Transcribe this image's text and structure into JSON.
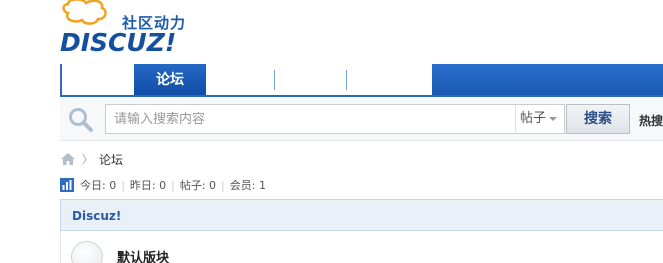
{
  "logo": {
    "tagline": "社区动力",
    "wordmark": "DISCUZ!"
  },
  "nav": {
    "tabs": [
      {
        "label": "论坛",
        "active": true
      }
    ],
    "accent_color": "#1a59b3"
  },
  "search": {
    "placeholder": "请输入搜索内容",
    "value": "",
    "type_selected": "帖子",
    "button_label": "搜索",
    "hot_label": "热搜"
  },
  "breadcrumb": {
    "home_icon": "home-icon",
    "separator": "〉",
    "current": "论坛"
  },
  "stats": {
    "icon": "bar-chart-icon",
    "today": "今日: 0",
    "yesterday": "昨日: 0",
    "posts": "帖子: 0",
    "members": "会员: 1",
    "separator": "|"
  },
  "category": {
    "title": "Discuz!",
    "forums": [
      {
        "name": "默认版块",
        "icon": "forum-icon"
      }
    ]
  }
}
